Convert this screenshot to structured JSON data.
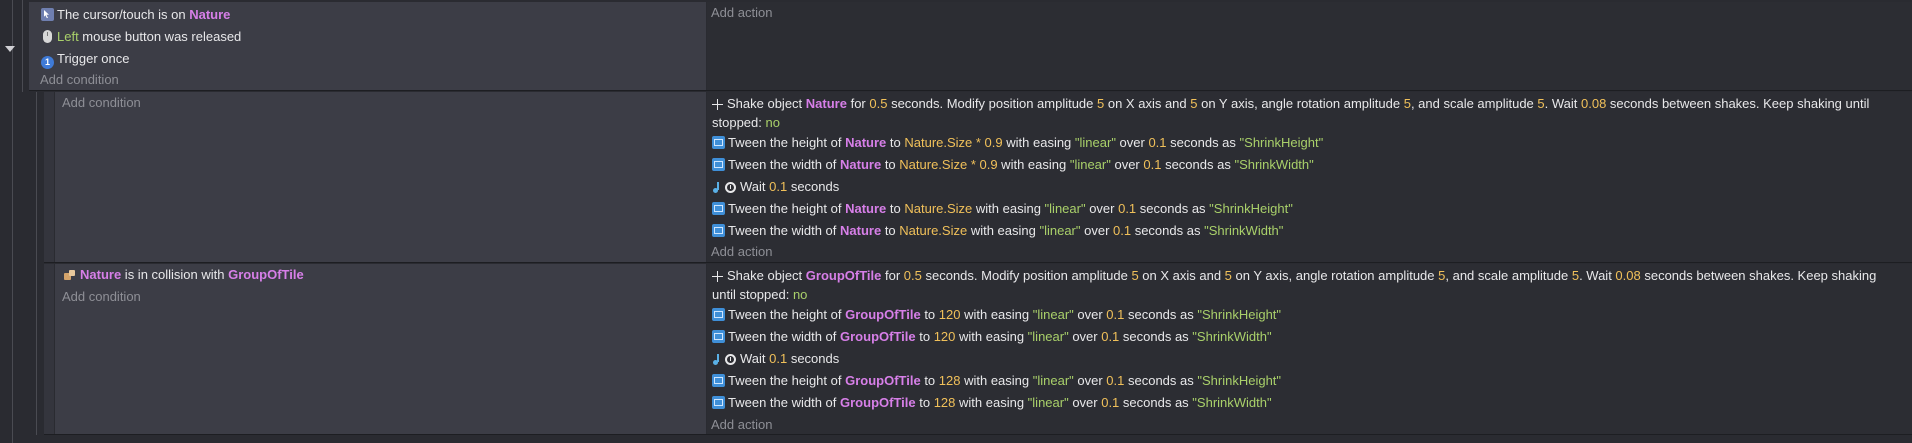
{
  "event1": {
    "conditions": [
      {
        "pre": "The cursor/touch is on ",
        "obj": "Nature"
      },
      {
        "green": "Left",
        "post": " mouse button was released"
      },
      {
        "text": "Trigger once"
      }
    ],
    "add_condition": "Add condition",
    "add_action": "Add action"
  },
  "sub1": {
    "add_condition": "Add condition",
    "actions": {
      "shake": {
        "t1": "Shake object ",
        "obj": "Nature",
        "t2": " for ",
        "n1": "0.5",
        "t3": " seconds. Modify position amplitude ",
        "n2": "5",
        "t4": " on X axis and ",
        "n3": "5",
        "t5": " on Y axis, angle rotation amplitude ",
        "n4": "5",
        "t6": ", and scale amplitude ",
        "n5": "5",
        "t7": ". Wait ",
        "n6": "0.08",
        "t8": " seconds between shakes. Keep shaking until stopped: ",
        "g": "no"
      },
      "tweens_a": [
        {
          "t1": "Tween the height of ",
          "obj": "Nature",
          "t2": " to ",
          "val": "Nature.Size * 0.9",
          "t3": " with easing ",
          "ease": "\"linear\"",
          "t4": " over ",
          "dur": "0.1",
          "t5": " seconds as ",
          "id": "\"ShrinkHeight\""
        },
        {
          "t1": "Tween the width of ",
          "obj": "Nature",
          "t2": " to ",
          "val": "Nature.Size * 0.9",
          "t3": " with easing ",
          "ease": "\"linear\"",
          "t4": " over ",
          "dur": "0.1",
          "t5": " seconds as ",
          "id": "\"ShrinkWidth\""
        }
      ],
      "wait": {
        "t1": "Wait ",
        "n": "0.1",
        "t2": " seconds"
      },
      "tweens_b": [
        {
          "t1": "Tween the height of ",
          "obj": "Nature",
          "t2": " to ",
          "val": "Nature.Size",
          "t3": " with easing ",
          "ease": "\"linear\"",
          "t4": " over ",
          "dur": "0.1",
          "t5": " seconds as ",
          "id": "\"ShrinkHeight\""
        },
        {
          "t1": "Tween the width of ",
          "obj": "Nature",
          "t2": " to ",
          "val": "Nature.Size",
          "t3": " with easing ",
          "ease": "\"linear\"",
          "t4": " over ",
          "dur": "0.1",
          "t5": " seconds as ",
          "id": "\"ShrinkWidth\""
        }
      ]
    },
    "add_action": "Add action"
  },
  "sub2": {
    "condition": {
      "obj": "Nature",
      "t1": " is in collision with ",
      "obj2": "GroupOfTile"
    },
    "add_condition": "Add condition",
    "actions": {
      "shake": {
        "t1": "Shake object ",
        "obj": "GroupOfTile",
        "t2": " for ",
        "n1": "0.5",
        "t3": " seconds. Modify position amplitude ",
        "n2": "5",
        "t4": " on X axis and ",
        "n3": "5",
        "t5": " on Y axis, angle rotation amplitude ",
        "n4": "5",
        "t6": ", and scale amplitude ",
        "n5": "5",
        "t7": ". Wait ",
        "n6": "0.08",
        "t8": " seconds between shakes. Keep shaking until stopped: ",
        "g": "no"
      },
      "tweens_a": [
        {
          "t1": "Tween the height of ",
          "obj": "GroupOfTile",
          "t2": " to ",
          "val": "120",
          "t3": " with easing ",
          "ease": "\"linear\"",
          "t4": " over ",
          "dur": "0.1",
          "t5": " seconds as ",
          "id": "\"ShrinkHeight\""
        },
        {
          "t1": "Tween the width of ",
          "obj": "GroupOfTile",
          "t2": " to ",
          "val": "120",
          "t3": " with easing ",
          "ease": "\"linear\"",
          "t4": " over ",
          "dur": "0.1",
          "t5": " seconds as ",
          "id": "\"ShrinkWidth\""
        }
      ],
      "wait": {
        "t1": "Wait ",
        "n": "0.1",
        "t2": " seconds"
      },
      "tweens_b": [
        {
          "t1": "Tween the height of ",
          "obj": "GroupOfTile",
          "t2": " to ",
          "val": "128",
          "t3": " with easing ",
          "ease": "\"linear\"",
          "t4": " over ",
          "dur": "0.1",
          "t5": " seconds as ",
          "id": "\"ShrinkHeight\""
        },
        {
          "t1": "Tween the width of ",
          "obj": "GroupOfTile",
          "t2": " to ",
          "val": "128",
          "t3": " with easing ",
          "ease": "\"linear\"",
          "t4": " over ",
          "dur": "0.1",
          "t5": " seconds as ",
          "id": "\"ShrinkWidth\""
        }
      ]
    },
    "add_action": "Add action"
  }
}
